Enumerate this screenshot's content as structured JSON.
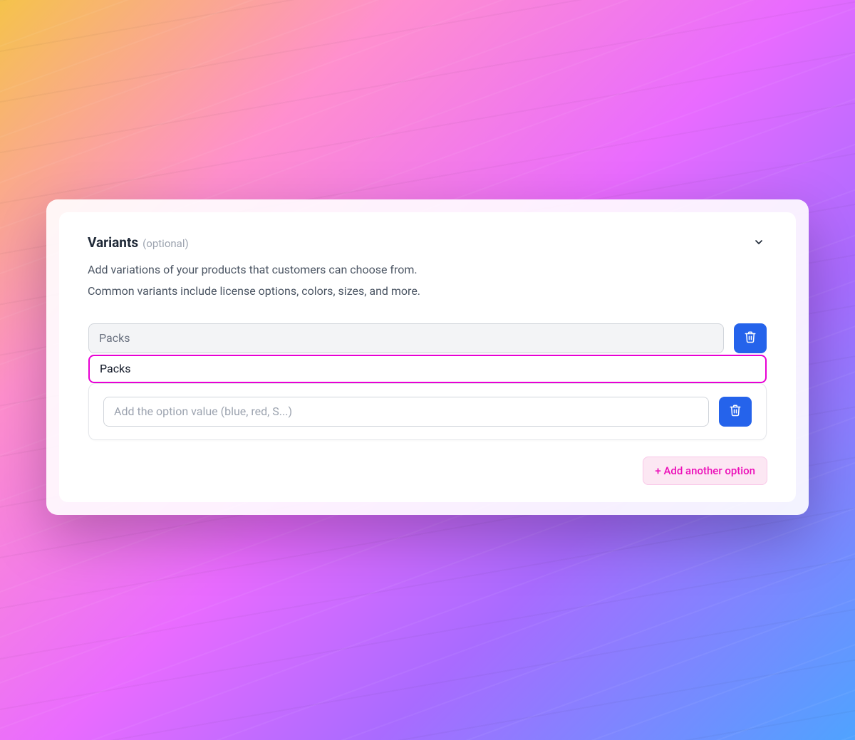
{
  "section": {
    "title": "Variants",
    "optional_label": "(optional)",
    "description_line1": "Add variations of your products that customers can choose from.",
    "description_line2": "Common variants include license options, colors, sizes, and more."
  },
  "option": {
    "name_display": "Packs",
    "name_editing": "Packs",
    "value_placeholder": "Add the option value (blue, red, S...)",
    "value": ""
  },
  "footer": {
    "add_another_label": "+ Add another option"
  },
  "colors": {
    "accent_pink": "#e800d4",
    "button_blue": "#2563eb",
    "pill_pink": "#fce7f3"
  }
}
